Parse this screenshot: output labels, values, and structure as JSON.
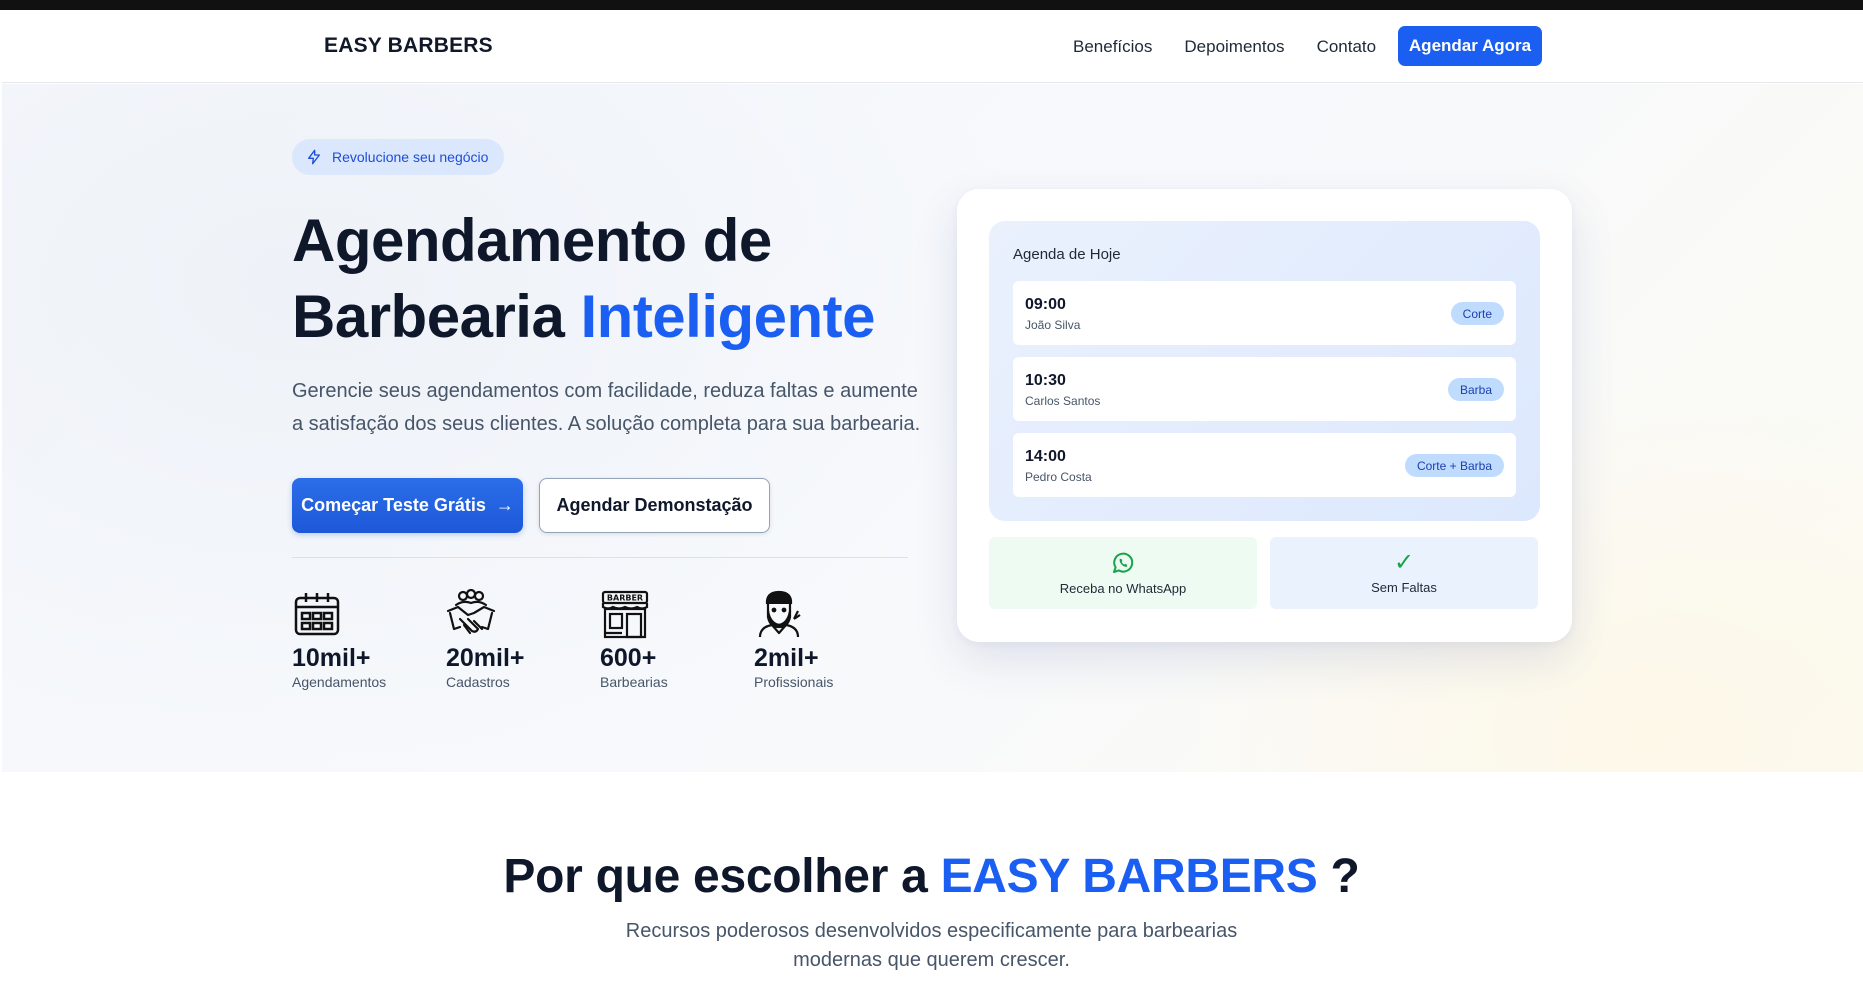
{
  "nav": {
    "brand": "EASY BARBERS",
    "links": [
      "Benefícios",
      "Depoimentos",
      "Contato"
    ],
    "cta": "Agendar Agora"
  },
  "hero": {
    "badge": "Revolucione seu negócio",
    "title_line1": "Agendamento de",
    "title_line2_prefix": "Barbearia ",
    "title_accent": "Inteligente",
    "lead": "Gerencie seus agendamentos com facilidade, reduza faltas e aumente a satisfação dos seus clientes. A solução completa para sua barbearia.",
    "primary_button": "Começar Teste Grátis",
    "secondary_button": "Agendar Demonstação",
    "stats": [
      {
        "value": "10mil+",
        "label": "Agendamentos",
        "icon": "calendar-icon"
      },
      {
        "value": "20mil+",
        "label": "Cadastros",
        "icon": "handshake-icon"
      },
      {
        "value": "600+",
        "label": "Barbearias",
        "icon": "barber-shop-icon"
      },
      {
        "value": "2mil+",
        "label": "Profissionais",
        "icon": "barber-icon"
      }
    ],
    "barber_sign": "BARBER"
  },
  "agenda_card": {
    "title": "Agenda de Hoje",
    "appointments": [
      {
        "time": "09:00",
        "name": "João Silva",
        "service": "Corte"
      },
      {
        "time": "10:30",
        "name": "Carlos Santos",
        "service": "Barba"
      },
      {
        "time": "14:00",
        "name": "Pedro Costa",
        "service": "Corte + Barba"
      }
    ],
    "features": [
      {
        "label": "Receba no WhatsApp",
        "icon": "whatsapp-icon"
      },
      {
        "label": "Sem Faltas",
        "icon": "check-icon"
      }
    ]
  },
  "why": {
    "title_prefix": "Por que escolher a ",
    "title_accent": "EASY BARBERS",
    "title_suffix": " ?",
    "subtitle": "Recursos poderosos desenvolvidos especificamente para barbearias modernas que querem crescer."
  },
  "colors": {
    "accent": "#1a5ff2",
    "dark": "#0f172a",
    "whatsapp": "#16a34a"
  }
}
